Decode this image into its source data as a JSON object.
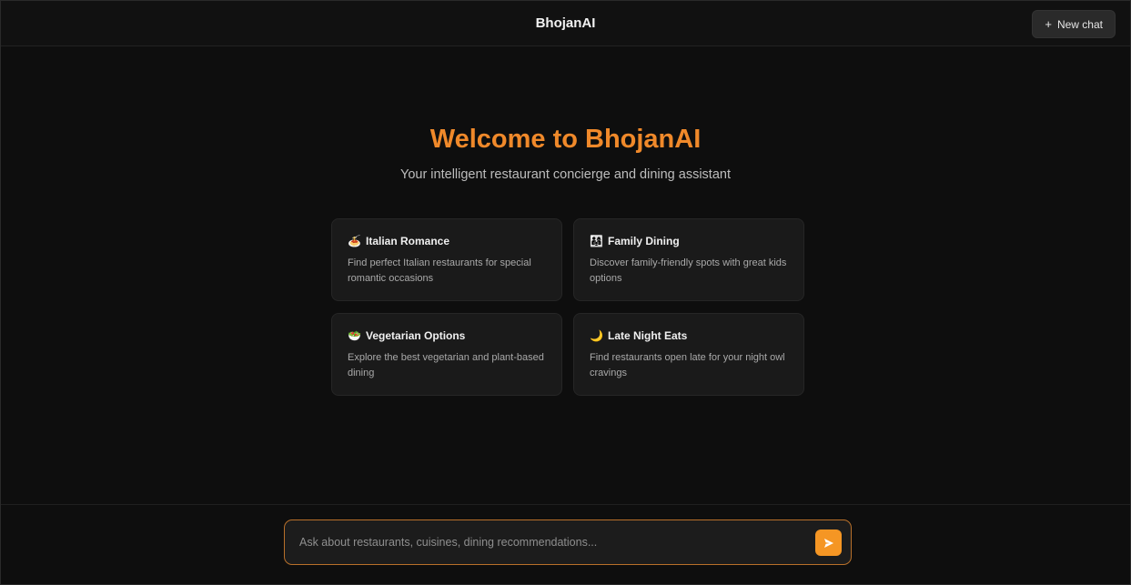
{
  "header": {
    "title": "BhojanAI",
    "new_chat_label": "New chat",
    "new_chat_icon": "+"
  },
  "hero": {
    "title": "Welcome to BhojanAI",
    "subtitle": "Your intelligent restaurant concierge and dining assistant"
  },
  "suggestions": [
    {
      "icon": "🍝",
      "icon_name": "pasta-icon",
      "title": "Italian Romance",
      "description": "Find perfect Italian restaurants for special romantic occasions"
    },
    {
      "icon": "👨‍👩‍👧",
      "icon_name": "family-icon",
      "title": "Family Dining",
      "description": "Discover family-friendly spots with great kids options"
    },
    {
      "icon": "🥗",
      "icon_name": "salad-icon",
      "title": "Vegetarian Options",
      "description": "Explore the best vegetarian and plant-based dining"
    },
    {
      "icon": "🌙",
      "icon_name": "moon-icon",
      "title": "Late Night Eats",
      "description": "Find restaurants open late for your night owl cravings"
    }
  ],
  "composer": {
    "placeholder": "Ask about restaurants, cuisines, dining recommendations...",
    "value": "",
    "send_icon": "send-icon"
  },
  "colors": {
    "accent": "#f0892a",
    "send_button": "#f59624",
    "input_border": "#b8702a",
    "background": "#0e0e0e",
    "card": "#1a1a1a"
  }
}
